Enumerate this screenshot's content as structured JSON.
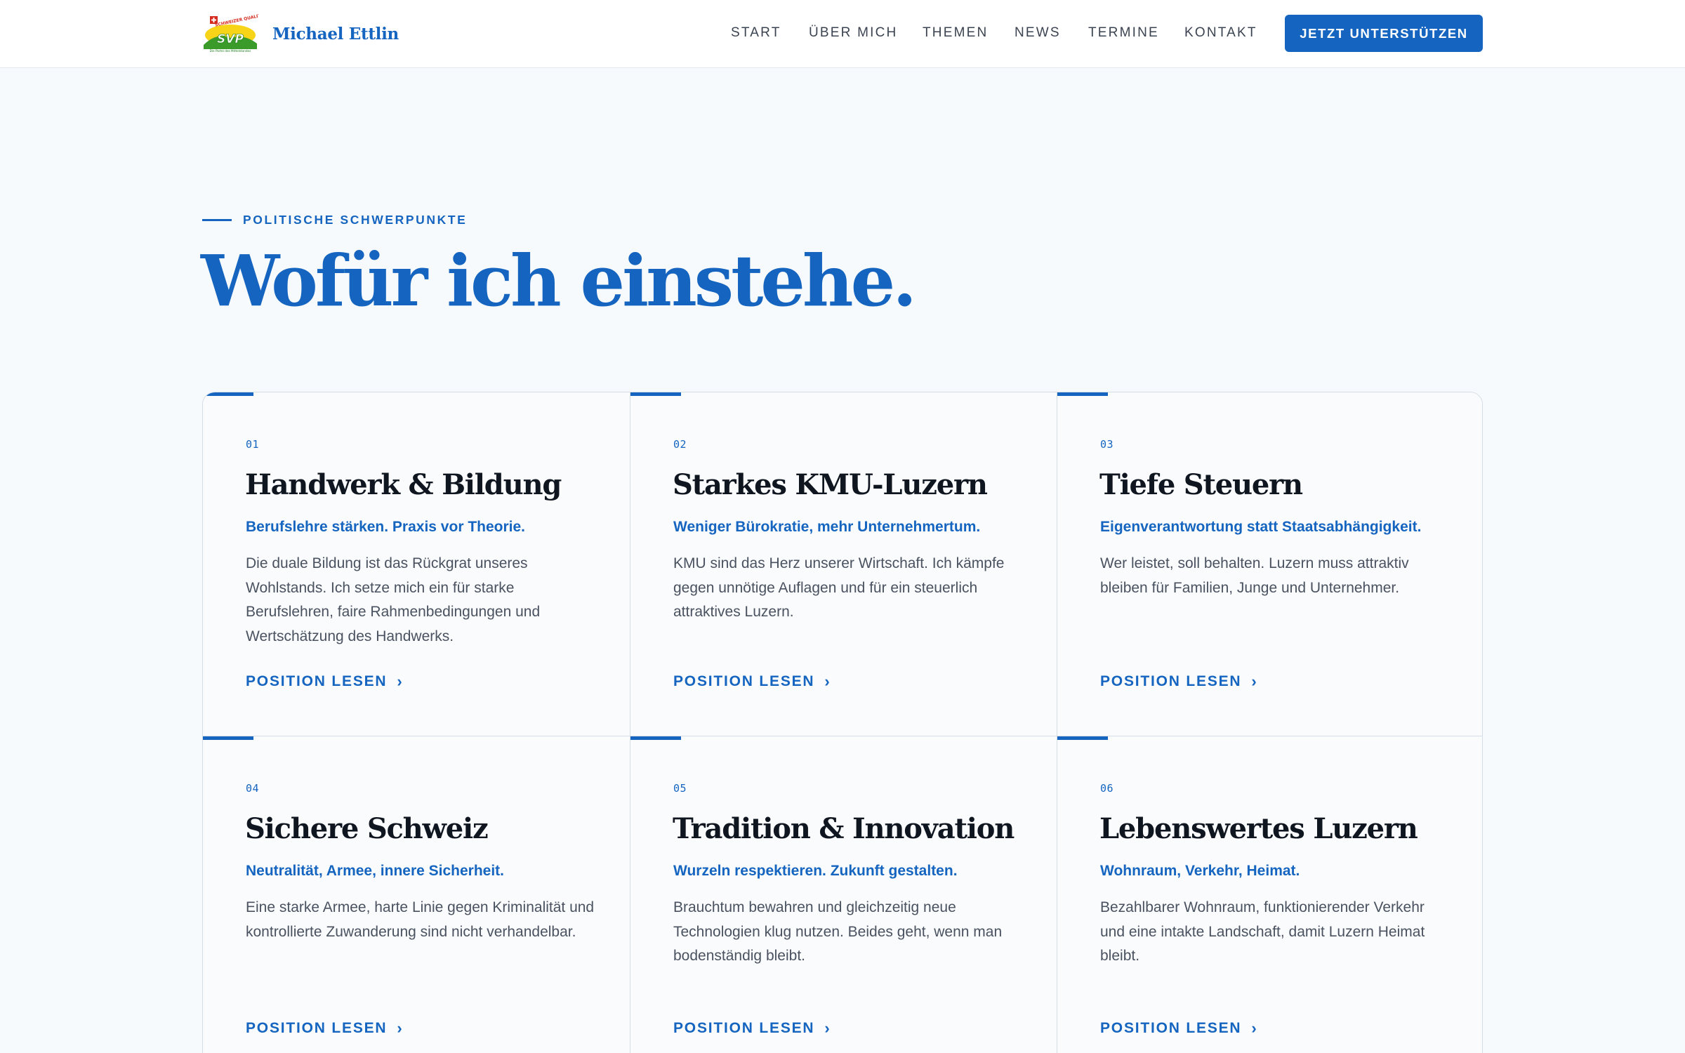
{
  "header": {
    "brand_name": "Michael Ettlin",
    "logo": {
      "party": "SVP",
      "tagline": "SCHWEIZER QUALITÄT",
      "slogan": "Die Partei des Mittelstandes"
    },
    "nav": [
      {
        "label": "START"
      },
      {
        "label": "ÜBER MICH"
      },
      {
        "label": "THEMEN"
      },
      {
        "label": "NEWS"
      },
      {
        "label": "TERMINE"
      },
      {
        "label": "KONTAKT"
      }
    ],
    "cta_label": "JETZT UNTERSTÜTZEN"
  },
  "section": {
    "eyebrow": "POLITISCHE SCHWERPUNKTE",
    "headline": "Wofür ich einstehe."
  },
  "cards": [
    {
      "number": "01",
      "title": "Handwerk & Bildung",
      "subtitle": "Berufslehre stärken. Praxis vor Theorie.",
      "body": "Die duale Bildung ist das Rückgrat unseres Wohlstands. Ich setze mich ein für starke Berufslehren, faire Rahmenbedingungen und Wertschätzung des Handwerks.",
      "link": "POSITION LESEN"
    },
    {
      "number": "02",
      "title": "Starkes KMU-Luzern",
      "subtitle": "Weniger Bürokratie, mehr Unternehmertum.",
      "body": "KMU sind das Herz unserer Wirtschaft. Ich kämpfe gegen unnötige Auflagen und für ein steuerlich attraktives Luzern.",
      "link": "POSITION LESEN"
    },
    {
      "number": "03",
      "title": "Tiefe Steuern",
      "subtitle": "Eigenverantwortung statt Staatsabhängigkeit.",
      "body": "Wer leistet, soll behalten. Luzern muss attraktiv bleiben für Familien, Junge und Unternehmer.",
      "link": "POSITION LESEN"
    },
    {
      "number": "04",
      "title": "Sichere Schweiz",
      "subtitle": "Neutralität, Armee, innere Sicherheit.",
      "body": "Eine starke Armee, harte Linie gegen Kriminalität und kontrollierte Zuwanderung sind nicht verhandelbar.",
      "link": "POSITION LESEN"
    },
    {
      "number": "05",
      "title": "Tradition & Innovation",
      "subtitle": "Wurzeln respektieren. Zukunft gestalten.",
      "body": "Brauchtum bewahren und gleichzeitig neue Technologien klug nutzen. Beides geht, wenn man bodenständig bleibt.",
      "link": "POSITION LESEN"
    },
    {
      "number": "06",
      "title": "Lebenswertes Luzern",
      "subtitle": "Wohnraum, Verkehr, Heimat.",
      "body": "Bezahlbarer Wohnraum, funktionierender Verkehr und eine intakte Landschaft, damit Luzern Heimat bleibt.",
      "link": "POSITION LESEN"
    }
  ],
  "colors": {
    "accent": "#1565c0",
    "background": "#f7fafc",
    "border": "#d7dde5"
  }
}
